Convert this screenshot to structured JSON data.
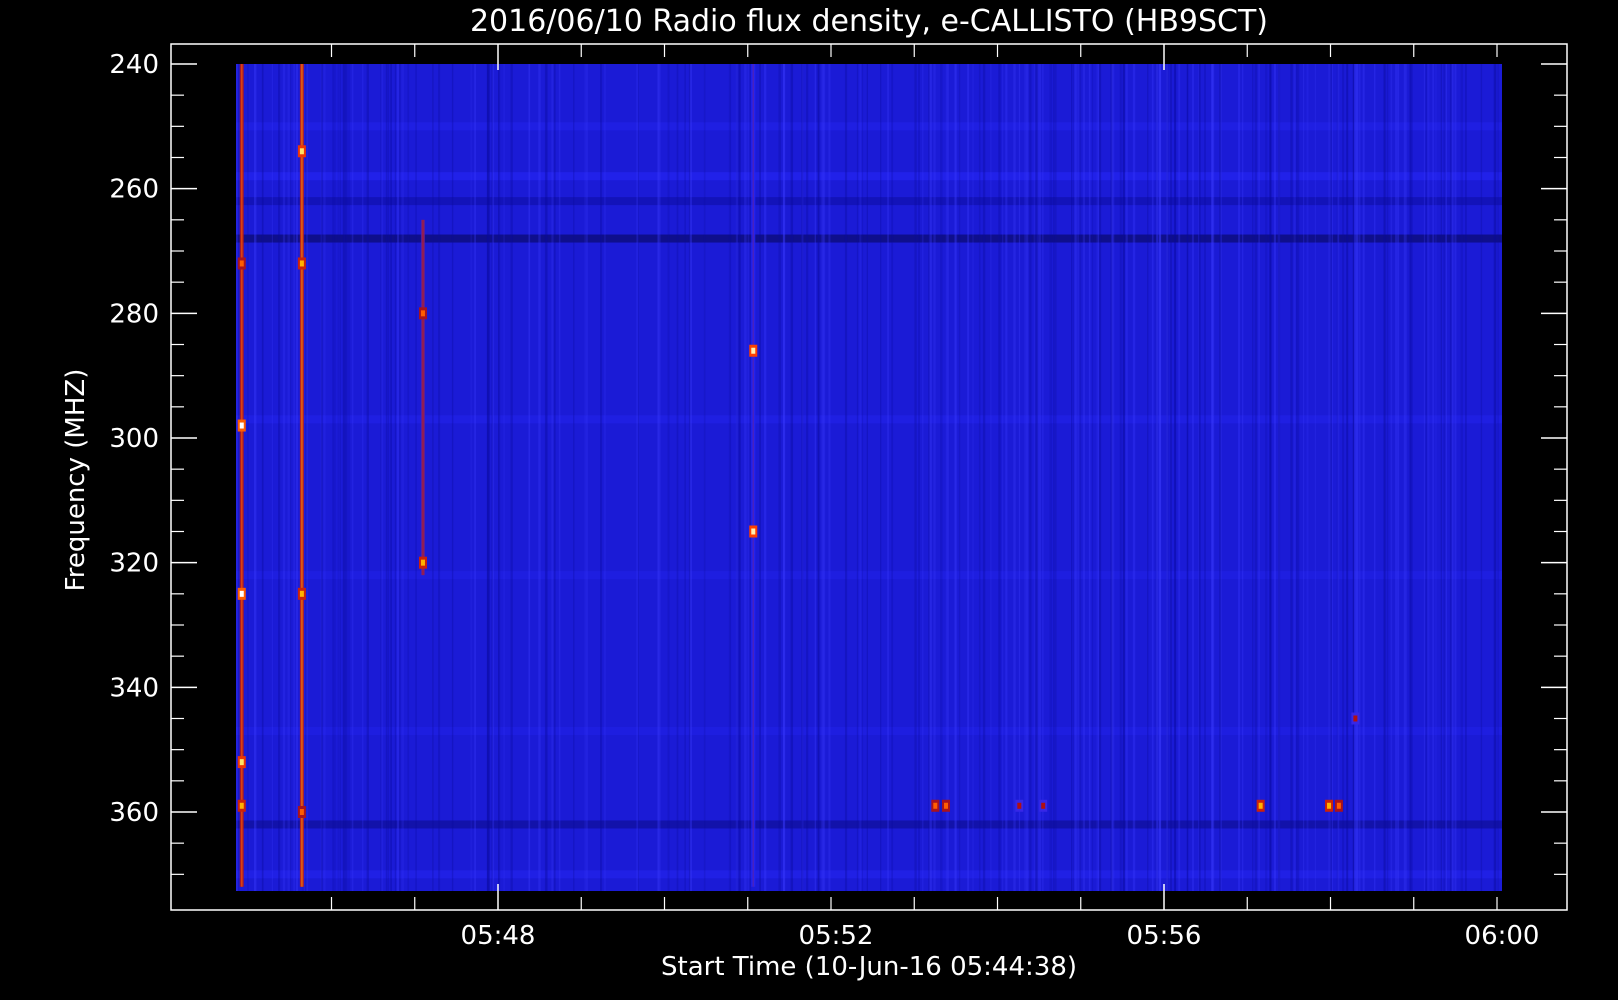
{
  "chart_data": {
    "type": "heatmap",
    "title": "2016/06/10  Radio flux density, e-CALLISTO (HB9SCT)",
    "xlabel": "Start Time (10-Jun-16 05:44:38)",
    "ylabel": "Frequency (MHZ)",
    "x_ticks": [
      "05:48",
      "05:52",
      "05:56",
      "06:00"
    ],
    "y_ticks": [
      "240",
      "260",
      "280",
      "300",
      "320",
      "340",
      "360"
    ],
    "y_tick_values": [
      240,
      260,
      280,
      300,
      320,
      340,
      360
    ],
    "ylim": [
      372,
      237
    ],
    "x_range_minutes": [
      0,
      15.37
    ],
    "colormap": [
      "#000000",
      "#1010c8",
      "#2a2aff",
      "#b01010",
      "#ff4000",
      "#ffd000",
      "#ffffff"
    ],
    "background_color": "#1b1bd6",
    "bursts": [
      {
        "minute": 0.07,
        "freq_start": 240,
        "freq_end": 372,
        "intensity": 0.7
      },
      {
        "minute": 0.8,
        "freq_start": 240,
        "freq_end": 372,
        "intensity": 0.75
      },
      {
        "minute": 2.27,
        "freq_start": 265,
        "freq_end": 322,
        "intensity": 0.55
      },
      {
        "minute": 6.28,
        "freq_start": 240,
        "freq_end": 372,
        "intensity": 0.4
      }
    ],
    "hot_spots": [
      {
        "minute": 0.07,
        "freq": 298,
        "intensity": 1.0
      },
      {
        "minute": 0.07,
        "freq": 325,
        "intensity": 1.0
      },
      {
        "minute": 0.07,
        "freq": 352,
        "intensity": 0.9
      },
      {
        "minute": 0.07,
        "freq": 359,
        "intensity": 0.8
      },
      {
        "minute": 0.07,
        "freq": 272,
        "intensity": 0.7
      },
      {
        "minute": 0.8,
        "freq": 254,
        "intensity": 0.9
      },
      {
        "minute": 0.8,
        "freq": 272,
        "intensity": 0.8
      },
      {
        "minute": 0.8,
        "freq": 325,
        "intensity": 0.8
      },
      {
        "minute": 0.8,
        "freq": 360,
        "intensity": 0.7
      },
      {
        "minute": 2.27,
        "freq": 280,
        "intensity": 0.7
      },
      {
        "minute": 2.27,
        "freq": 320,
        "intensity": 0.8
      },
      {
        "minute": 6.28,
        "freq": 286,
        "intensity": 0.95
      },
      {
        "minute": 6.28,
        "freq": 315,
        "intensity": 0.95
      },
      {
        "minute": 8.49,
        "freq": 359,
        "intensity": 0.7
      },
      {
        "minute": 8.62,
        "freq": 359,
        "intensity": 0.7
      },
      {
        "minute": 9.51,
        "freq": 359,
        "intensity": 0.5
      },
      {
        "minute": 9.8,
        "freq": 359,
        "intensity": 0.5
      },
      {
        "minute": 12.44,
        "freq": 359,
        "intensity": 0.8
      },
      {
        "minute": 13.27,
        "freq": 359,
        "intensity": 0.8
      },
      {
        "minute": 13.39,
        "freq": 359,
        "intensity": 0.7
      },
      {
        "minute": 13.59,
        "freq": 345,
        "intensity": 0.5
      }
    ],
    "horizontal_bands": [
      {
        "freq": 250,
        "level": 0.62
      },
      {
        "freq": 258,
        "level": 0.7
      },
      {
        "freq": 262,
        "level": 0.3
      },
      {
        "freq": 268,
        "level": 0.15
      },
      {
        "freq": 297,
        "level": 0.62
      },
      {
        "freq": 322,
        "level": 0.6
      },
      {
        "freq": 347,
        "level": 0.6
      },
      {
        "freq": 362,
        "level": 0.25
      },
      {
        "freq": 370,
        "level": 0.65
      }
    ]
  }
}
